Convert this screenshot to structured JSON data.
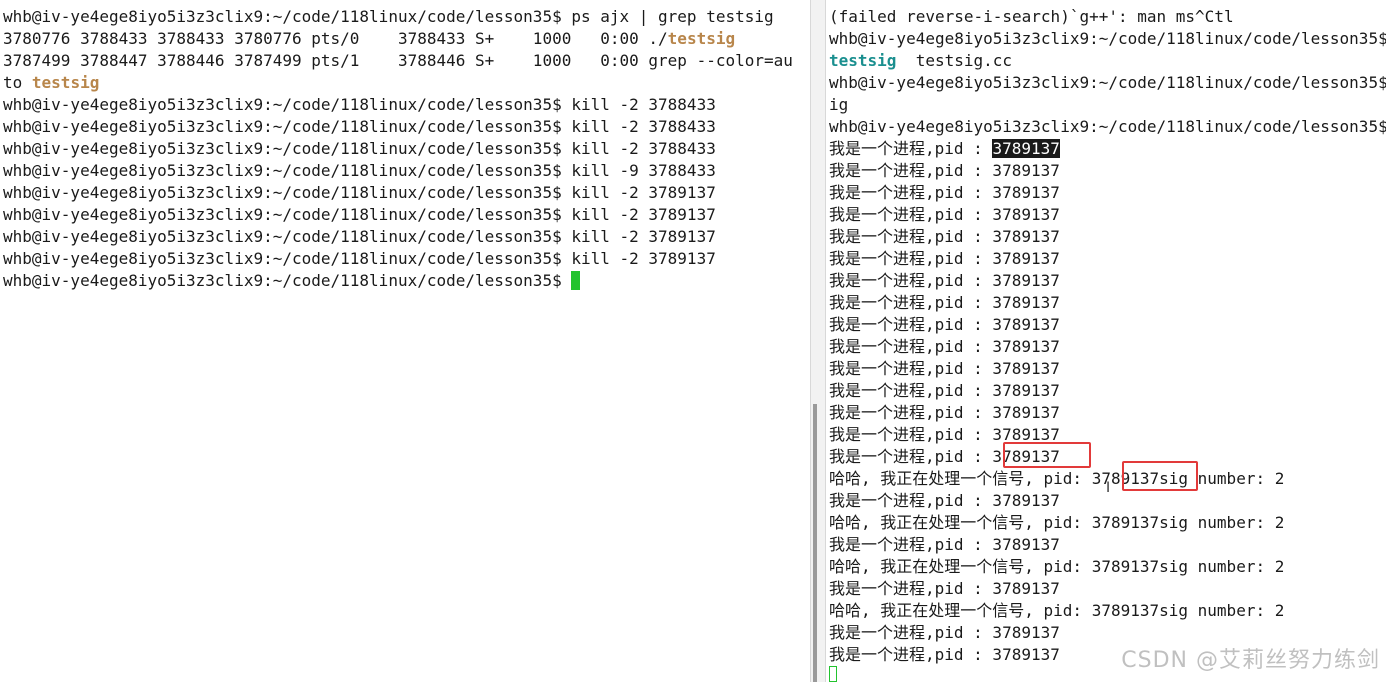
{
  "left_terminal": {
    "lines": [
      {
        "t": "whb@iv-ye4ege8iyo5i3z3clix9:~/code/118linux/code/lesson35$ ps ajx | grep testsig"
      },
      {
        "a": "3780776 3788433 3788433 3780776 pts/0    3788433 S+    1000   0:00 ./",
        "hl": "testsig"
      },
      {
        "t": "3787499 3788447 3788446 3787499 pts/1    3788446 S+    1000   0:00 grep --color=au"
      },
      {
        "a": "to ",
        "hl": "testsig"
      },
      {
        "t": "whb@iv-ye4ege8iyo5i3z3clix9:~/code/118linux/code/lesson35$ kill -2 3788433"
      },
      {
        "t": "whb@iv-ye4ege8iyo5i3z3clix9:~/code/118linux/code/lesson35$ kill -2 3788433"
      },
      {
        "t": "whb@iv-ye4ege8iyo5i3z3clix9:~/code/118linux/code/lesson35$ kill -2 3788433"
      },
      {
        "t": "whb@iv-ye4ege8iyo5i3z3clix9:~/code/118linux/code/lesson35$ kill -9 3788433"
      },
      {
        "t": "whb@iv-ye4ege8iyo5i3z3clix9:~/code/118linux/code/lesson35$ kill -2 3789137"
      },
      {
        "t": "whb@iv-ye4ege8iyo5i3z3clix9:~/code/118linux/code/lesson35$ kill -2 3789137"
      },
      {
        "t": "whb@iv-ye4ege8iyo5i3z3clix9:~/code/118linux/code/lesson35$ kill -2 3789137"
      },
      {
        "t": "whb@iv-ye4ege8iyo5i3z3clix9:~/code/118linux/code/lesson35$ kill -2 3789137"
      }
    ],
    "prompt_line": "whb@iv-ye4ege8iyo5i3z3clix9:~/code/118linux/code/lesson35$ "
  },
  "right_terminal": {
    "header_lines": [
      {
        "t": "(failed reverse-i-search)`g++': man ms^Ctl"
      },
      {
        "t": "whb@iv-ye4ege8iyo5i3z3clix9:~/code/118linux/code/lesson35$"
      },
      {
        "hl": "testsig",
        "b": "  testsig.cc"
      },
      {
        "t": "whb@iv-ye4ege8iyo5i3z3clix9:~/code/118linux/code/lesson35$"
      },
      {
        "t": "ig"
      },
      {
        "t": "whb@iv-ye4ege8iyo5i3z3clix9:~/code/118linux/code/lesson35$"
      }
    ],
    "first_output": {
      "prefix": "我是一个进程,pid : ",
      "pid": "3789137"
    },
    "output_lines": [
      "我是一个进程,pid : 3789137",
      "我是一个进程,pid : 3789137",
      "我是一个进程,pid : 3789137",
      "我是一个进程,pid : 3789137",
      "我是一个进程,pid : 3789137",
      "我是一个进程,pid : 3789137",
      "我是一个进程,pid : 3789137",
      "我是一个进程,pid : 3789137",
      "我是一个进程,pid : 3789137",
      "我是一个进程,pid : 3789137",
      "我是一个进程,pid : 3789137",
      "我是一个进程,pid : 3789137",
      "我是一个进程,pid : 3789137",
      "我是一个进程,pid : 3789137",
      "哈哈, 我正在处理一个信号, pid: 3789137sig number: 2",
      "我是一个进程,pid : 3789137",
      "哈哈, 我正在处理一个信号, pid: 3789137sig number: 2",
      "我是一个进程,pid : 3789137",
      "哈哈, 我正在处理一个信号, pid: 3789137sig number: 2",
      "我是一个进程,pid : 3789137",
      "哈哈, 我正在处理一个信号, pid: 3789137sig number: 2",
      "我是一个进程,pid : 3789137",
      "我是一个进程,pid : 3789137"
    ]
  },
  "watermark": "CSDN @艾莉丝努力练剑",
  "colors": {
    "highlight_orange": "#b8864b",
    "highlight_teal": "#1a8f8f",
    "cursor_green": "#22c32e",
    "annotation_red": "#e23a3a"
  }
}
